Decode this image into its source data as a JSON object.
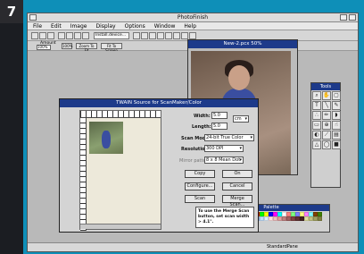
{
  "figure_number": "7",
  "app": {
    "title": "PhotoFinish"
  },
  "menu": [
    "File",
    "Edit",
    "Image",
    "Display",
    "Options",
    "Window",
    "Help"
  ],
  "toolbar": {
    "install_label": "Install.device..."
  },
  "toolbar2": {
    "zoom_label": "Amount",
    "zoom_value": "100%",
    "btn_100": "100%",
    "btn_zoom_fit": "Zoom To Fit",
    "btn_fit_screen": "Fit To Screen"
  },
  "image_window": {
    "title": "New-2.pcx 50%"
  },
  "tools_palette": {
    "title": "Tools",
    "icons": [
      "magnify-icon",
      "hand-icon",
      "select-icon",
      "text-icon",
      "line-icon",
      "brush-icon",
      "airbrush-icon",
      "pencil-icon",
      "fill-icon",
      "eraser-icon",
      "clone-icon",
      "smudge-icon",
      "contrast-icon",
      "dropper-icon",
      "stamp-icon",
      "sharpen-icon",
      "blur-icon",
      "color-icon"
    ]
  },
  "palette": {
    "title": "Palette",
    "colors": [
      "#000000",
      "#7f0000",
      "#007f00",
      "#7f7f00",
      "#00007f",
      "#7f007f",
      "#007f7f",
      "#c0c0c0",
      "#808080",
      "#ff0000",
      "#00ff00",
      "#ffff00",
      "#0000ff",
      "#ff00ff",
      "#00ffff",
      "#ffffff",
      "#ff8080",
      "#80ff80",
      "#8080ff",
      "#ffff80",
      "#ff80ff",
      "#80ffff",
      "#804000",
      "#408000",
      "#ffd0a0",
      "#d0a070",
      "#a07040",
      "#704020",
      "#203060",
      "#304080",
      "#4050a0",
      "#6070c0",
      "#80a0e0",
      "#a0c0f0",
      "#c0e0ff",
      "#e0f0ff",
      "#ffe0e0",
      "#f0c0c0",
      "#e0a0a0",
      "#c08080",
      "#a06060",
      "#804040",
      "#603030",
      "#402020",
      "#e0e0a0",
      "#c0c080",
      "#a0a060",
      "#808040"
    ]
  },
  "twain": {
    "title": "TWAIN Source for ScanMaker/Color",
    "width_label": "Width:",
    "width_value": "5.0",
    "length_label": "Length:",
    "length_value": "5.0",
    "unit": "cm",
    "scan_mode_label": "Scan Mode:",
    "scan_mode_value": "24-bit True Color",
    "resolution_label": "Resolution:",
    "resolution_value": "300 DPI",
    "mirror_label": "Mirror pattern:",
    "mirror_value": "8 x 8 Mean Dot",
    "buttons": {
      "copy": "Copy",
      "on": "On",
      "configure": "Configure...",
      "cancel": "Cancel",
      "scan": "Scan",
      "merge_scan": "Merge Scan..."
    },
    "info_text": "To use the Merge Scan button, set scan width > 4.1\"."
  },
  "status": {
    "label": "StandardPane"
  }
}
